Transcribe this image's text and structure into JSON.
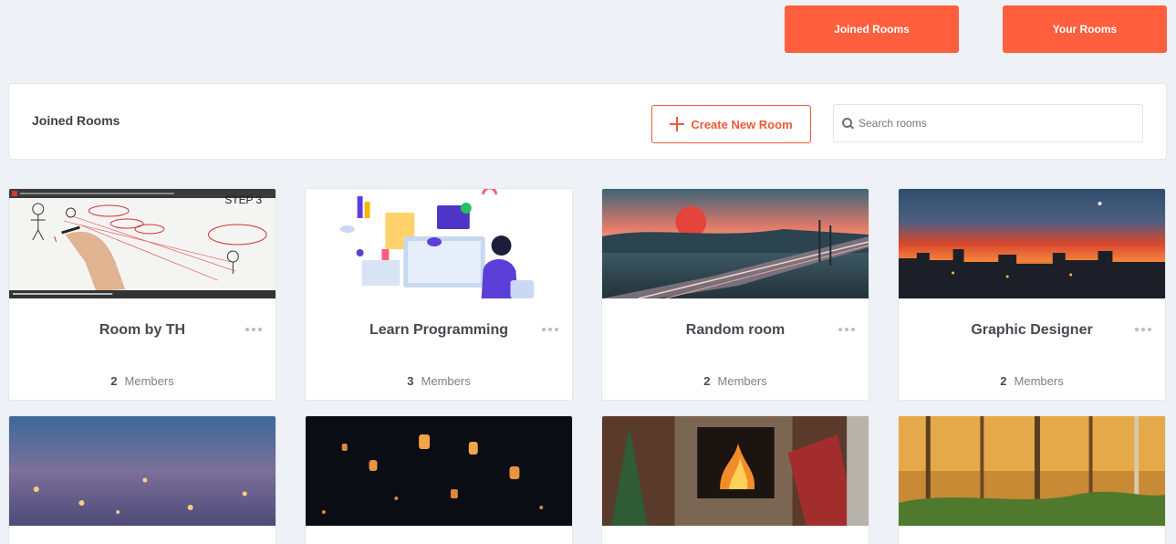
{
  "top_nav": {
    "joined_label": "Joined Rooms",
    "your_label": "Your Rooms"
  },
  "header": {
    "title": "Joined Rooms",
    "create_label": "Create New Room",
    "search_placeholder": "Search rooms"
  },
  "rooms": [
    {
      "name": "Room by TH",
      "members": "2",
      "members_label": "Members",
      "thumb": "whiteboard-video-thumbnail",
      "thumb_text": "STEP 3"
    },
    {
      "name": "Learn Programming",
      "members": "3",
      "members_label": "Members",
      "thumb": "programming-illustration"
    },
    {
      "name": "Random room",
      "members": "2",
      "members_label": "Members",
      "thumb": "sunset-highway-landscape"
    },
    {
      "name": "Graphic Designer",
      "members": "2",
      "members_label": "Members",
      "thumb": "red-sky-city-landscape"
    },
    {
      "thumb": "floating-lanterns-water"
    },
    {
      "thumb": "sky-lanterns-night"
    },
    {
      "thumb": "fireplace-christmas"
    },
    {
      "thumb": "autumn-forest"
    }
  ],
  "colors": {
    "accent": "#ff5f3d",
    "accent_outline": "#ee5a38",
    "background": "#eef2f6"
  }
}
